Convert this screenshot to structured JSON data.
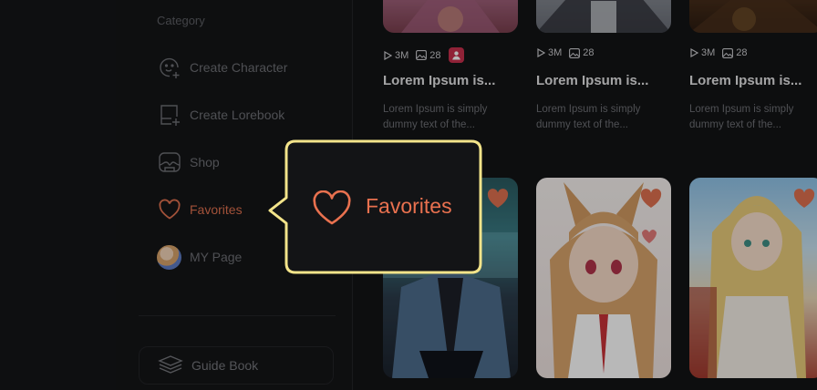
{
  "sidebar": {
    "category_title": "Category",
    "items": [
      {
        "label": "Create Character",
        "icon": "smiley-plus-icon"
      },
      {
        "label": "Create Lorebook",
        "icon": "book-plus-icon"
      },
      {
        "label": "Shop",
        "icon": "shop-icon"
      },
      {
        "label": "Favorites",
        "icon": "heart-icon",
        "active": true
      },
      {
        "label": "MY Page",
        "icon": "avatar"
      }
    ],
    "guide_label": "Guide Book",
    "guide_icon": "layers-icon"
  },
  "cards_top": [
    {
      "plays": "3M",
      "images": "28",
      "title": "Lorem Ipsum is...",
      "desc_line1": "Lorem Ipsum is simply",
      "desc_line2": "dummy text of the...",
      "badge": true
    },
    {
      "plays": "3M",
      "images": "28",
      "title": "Lorem Ipsum is...",
      "desc_line1": "Lorem Ipsum is simply",
      "desc_line2": "dummy text of the..."
    },
    {
      "plays": "3M",
      "images": "28",
      "title": "Lorem Ipsum is...",
      "desc_line1": "Lorem Ipsum is simply",
      "desc_line2": "dummy text of the..."
    }
  ],
  "callout": {
    "label": "Favorites",
    "icon": "heart-icon"
  },
  "colors": {
    "accent": "#e0714f",
    "callout_border": "#f3e48a",
    "badge": "#c8304d"
  }
}
